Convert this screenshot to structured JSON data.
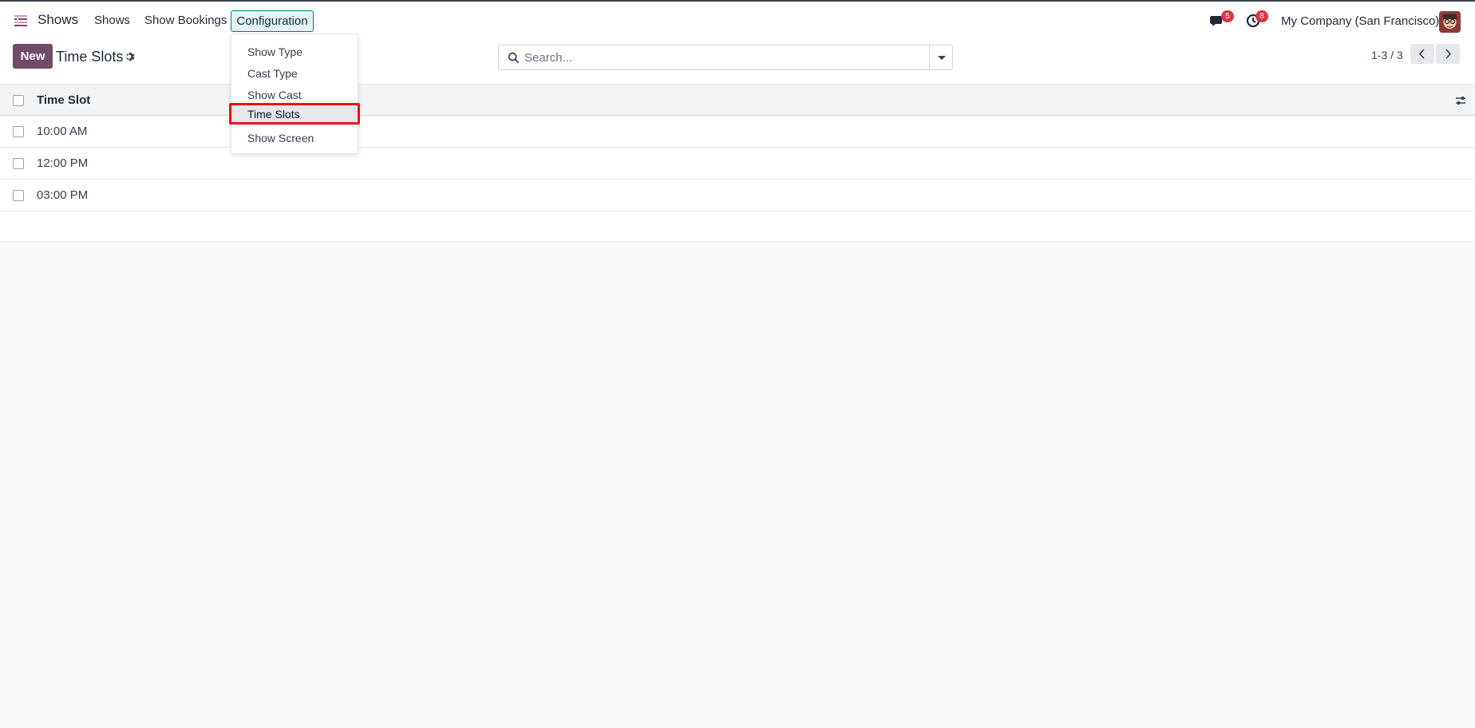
{
  "app": {
    "brand": "Shows"
  },
  "nav": {
    "items": [
      "Shows",
      "Show Bookings"
    ],
    "config_label": "Configuration"
  },
  "systray": {
    "messages_count": "5",
    "activities_count": "8",
    "company": "My Company (San Francisco)"
  },
  "control": {
    "new_label": "New",
    "title": "Time Slots",
    "search_placeholder": "Search...",
    "pager": "1-3 / 3"
  },
  "table": {
    "header": "Time Slot",
    "rows": [
      "10:00 AM",
      "12:00 PM",
      "03:00 PM"
    ]
  },
  "dropdown": {
    "items": [
      "Show Type",
      "Cast Type",
      "Show Cast",
      "Time Slots",
      "Show Screen"
    ],
    "active": "Time Slots"
  },
  "colors": {
    "brand": "#714b67",
    "highlight": "#e11111",
    "accent": "#017e84"
  }
}
